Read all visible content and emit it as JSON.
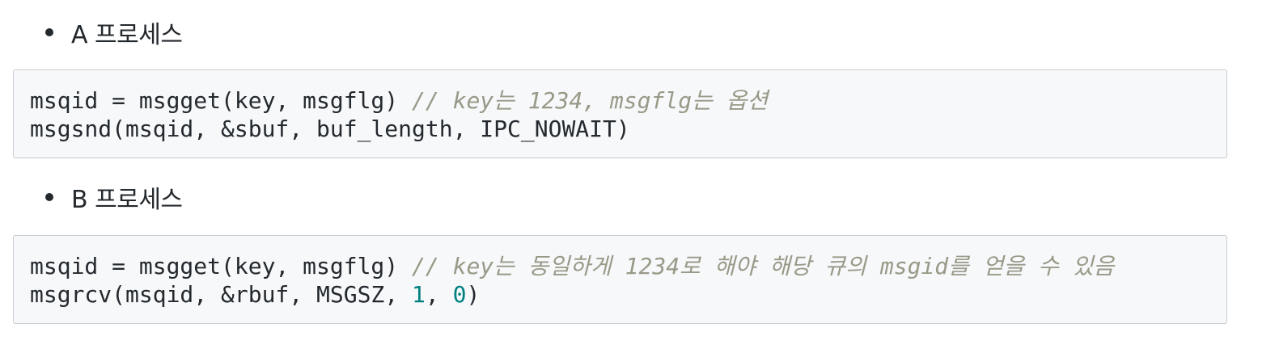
{
  "sections": [
    {
      "bullet": "A 프로세스",
      "code": {
        "line1_code": "msqid = msgget(key, msgflg) ",
        "line1_comment": "// key는 1234, msgflg는 옵션",
        "line2_code": "msgsnd(msqid, &sbuf, buf_length, IPC_NOWAIT)"
      }
    },
    {
      "bullet": "B 프로세스",
      "code": {
        "line1_code": "msqid = msgget(key, msgflg) ",
        "line1_comment": "// key는 동일하게 1234로 해야 해당 큐의 msgid를 얻을 수 있음",
        "line2_pre": "msgrcv(msqid, &rbuf, MSGSZ, ",
        "line2_num1": "1",
        "line2_sep": ", ",
        "line2_num2": "0",
        "line2_post": ")"
      }
    }
  ],
  "colors": {
    "text": "#24292e",
    "comment": "#999988",
    "number": "#008080",
    "code_bg": "#f6f8fa",
    "code_border": "#c9cdd1"
  }
}
